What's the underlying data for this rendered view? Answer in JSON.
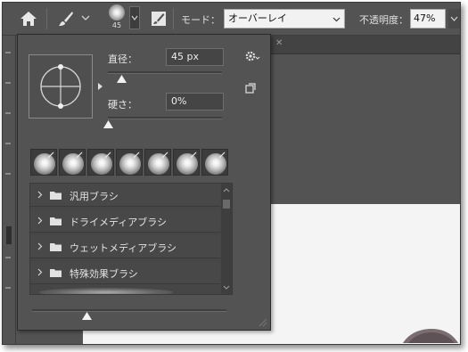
{
  "toolbar": {
    "preset_size": "45",
    "mode_label": "モード：",
    "mode_value": "オーバーレイ",
    "opacity_label": "不透明度：",
    "opacity_value": "47%"
  },
  "picker": {
    "diameter_label": "直径：",
    "diameter_value": "45 px",
    "diameter_level": 0.12,
    "hardness_label": "硬さ：",
    "hardness_value": "0%",
    "hardness_level": 0.0,
    "size_slider_level": 0.28,
    "tips_count": 7,
    "groups": [
      {
        "label": "汎用ブラシ"
      },
      {
        "label": "ドライメディアブラシ"
      },
      {
        "label": "ウェットメディアブラシ"
      },
      {
        "label": "特殊効果ブラシ"
      }
    ]
  },
  "colors": {
    "panel": "#535353",
    "field": "#454545",
    "input_light": "#f2f2f2"
  },
  "icons": [
    "home-icon",
    "brush-icon",
    "chevron-down-icon",
    "brush-panel-icon",
    "gear-icon",
    "new-preset-icon",
    "folder-icon",
    "chevron-right-icon"
  ]
}
